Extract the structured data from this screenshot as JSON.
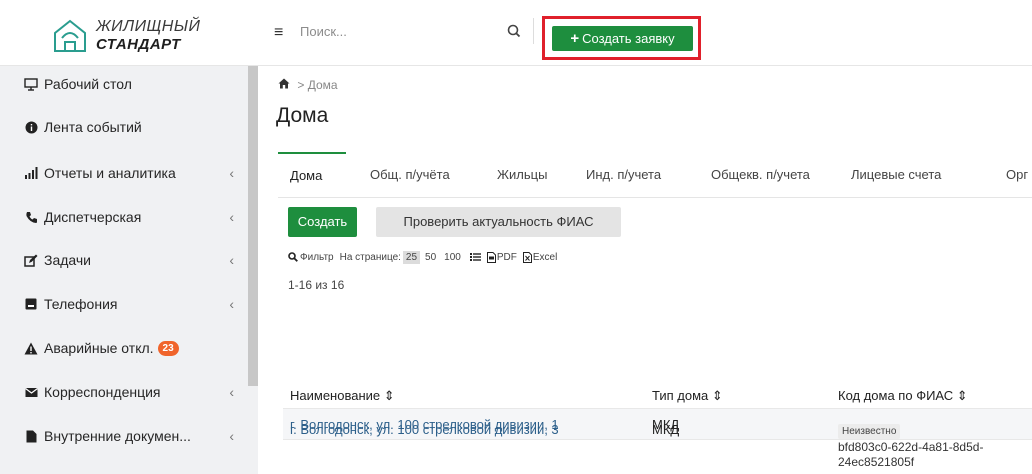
{
  "header": {
    "logo_line1": "ЖИЛИЩНЫЙ",
    "logo_line2": "СТАНДАРТ",
    "search_placeholder": "Поиск...",
    "create_request_label": "Создать заявку",
    "create_request_icon": "plus-icon",
    "highlight_color": "#e0202b"
  },
  "sidebar": {
    "items": [
      {
        "label": "Рабочий стол",
        "icon": "desktop-icon",
        "has_submenu": false
      },
      {
        "label": "Лента событий",
        "icon": "info-circle-icon",
        "has_submenu": false
      },
      {
        "label": "Отчеты и аналитика",
        "icon": "signal-bars-icon",
        "has_submenu": true
      },
      {
        "label": "Диспетчерская",
        "icon": "phone-icon",
        "has_submenu": true
      },
      {
        "label": "Задачи",
        "icon": "edit-icon",
        "has_submenu": true
      },
      {
        "label": "Телефония",
        "icon": "square-icon",
        "has_submenu": true
      },
      {
        "label": "Аварийные откл.",
        "icon": "warning-icon",
        "has_submenu": false,
        "badge": "23"
      },
      {
        "label": "Корреспонденция",
        "icon": "envelope-icon",
        "has_submenu": true
      },
      {
        "label": "Внутренние докумен...",
        "icon": "document-icon",
        "has_submenu": true
      }
    ],
    "chevron": "‹"
  },
  "breadcrumb": {
    "separator": ">",
    "current": "Дома"
  },
  "page": {
    "title": "Дома"
  },
  "tabs": [
    {
      "label": "Дома",
      "active": true
    },
    {
      "label": "Общ. п/учёта",
      "active": false
    },
    {
      "label": "Жильцы",
      "active": false
    },
    {
      "label": "Инд. п/учета",
      "active": false
    },
    {
      "label": "Общекв. п/учета",
      "active": false
    },
    {
      "label": "Лицевые счета",
      "active": false
    },
    {
      "label": "Орг",
      "active": false
    }
  ],
  "actions": {
    "create_label": "Создать",
    "fias_check_label": "Проверить актуальность ФИАС"
  },
  "toolbar": {
    "filter_label": "Фильтр",
    "per_page_label": "На странице:",
    "per_page_options": [
      "25",
      "50",
      "100"
    ],
    "per_page_selected": "25",
    "pdf_label": "PDF",
    "excel_label": "Excel"
  },
  "range_text": "1-16 из 16",
  "table": {
    "columns": [
      "Наименование ⇕",
      "Тип дома ⇕",
      "Код дома по ФИАС ⇕"
    ],
    "rows": [
      {
        "name": "г. Волгодонск, ул. 100 стрелковой дивизии, 1",
        "type": "МКД",
        "fias_status": "",
        "fias_code": ""
      },
      {
        "name": "г. Волгодонск, ул. 100 стрелковой дивизии, 3",
        "type": "МКД",
        "fias_status": "Неизвестно",
        "fias_code": "bfd803c0-622d-4a81-8d5d-24ec8521805f"
      }
    ]
  },
  "colors": {
    "accent": "#1e8e3e",
    "badge": "#f0642b",
    "link": "#2c5f8a",
    "sidebar_bg": "#f0f1f3"
  }
}
